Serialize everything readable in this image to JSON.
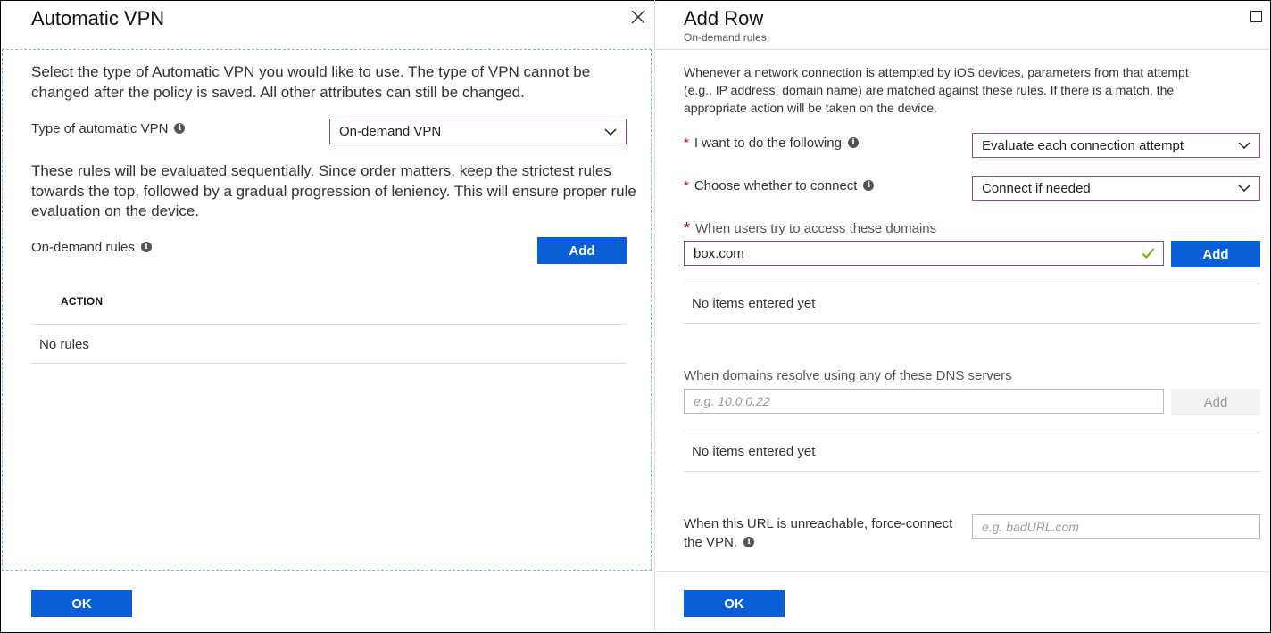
{
  "left_blade": {
    "title": "Automatic VPN",
    "intro": "Select the type of Automatic VPN you would like to use. The type of VPN cannot be changed after the policy is saved. All other attributes can still be changed.",
    "vpn_type_label": "Type of automatic VPN",
    "vpn_type_value": "On-demand VPN",
    "rules_note": "These rules will be evaluated sequentially. Since order matters, keep the strictest rules towards the top, followed by a gradual progression of leniency. This will ensure proper rule evaluation on the device.",
    "rules_label": "On-demand rules",
    "add_label": "Add",
    "table": {
      "column_action": "ACTION",
      "empty_text": "No rules"
    },
    "ok_label": "OK"
  },
  "right_blade": {
    "title": "Add Row",
    "subtitle": "On-demand rules",
    "description": "Whenever a network connection is attempted by iOS devices, parameters from that attempt (e.g., IP address, domain name) are matched against these rules. If there is a match, the appropriate action will be taken on the device.",
    "want_label": "I want to do the following",
    "want_value": "Evaluate each connection attempt",
    "connect_label": "Choose whether to connect",
    "connect_value": "Connect if needed",
    "domains_label": "When users try to access these domains",
    "domains_input_value": "box.com",
    "domains_add_label": "Add",
    "domains_empty": "No items entered yet",
    "dns_label": "When domains resolve using any of these DNS servers",
    "dns_placeholder": "e.g. 10.0.0.22",
    "dns_add_label": "Add",
    "dns_empty": "No items entered yet",
    "url_label_line1": "When this URL is unreachable, force-connect",
    "url_label_line2": "the VPN.",
    "url_placeholder": "e.g. badURL.com",
    "ok_label": "OK"
  },
  "colors": {
    "accent": "#0b5fd6",
    "active_border": "#8c4f8c",
    "required": "#c50f1f",
    "valid_check": "#6bb700"
  }
}
